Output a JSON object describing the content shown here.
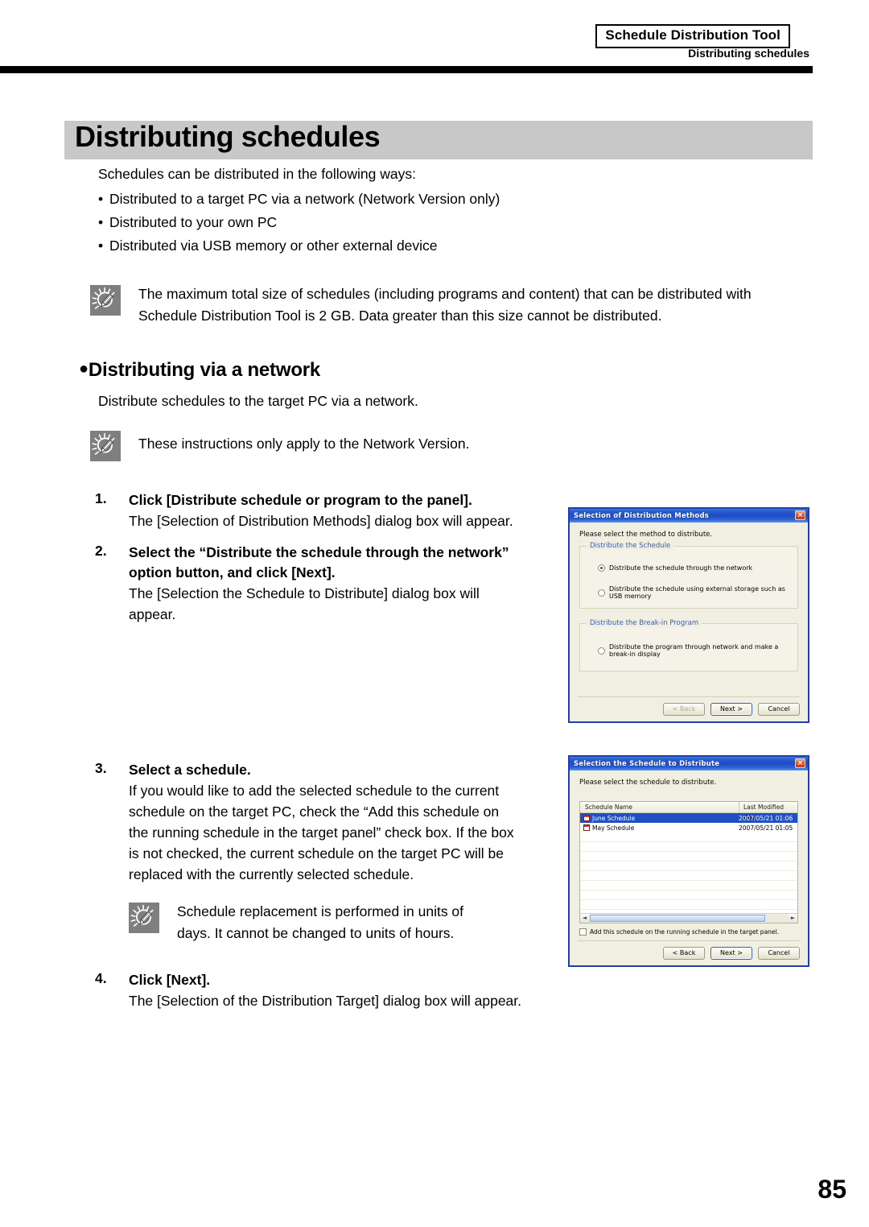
{
  "header": {
    "tool_name": "Schedule Distribution Tool",
    "running_head": "Distributing schedules"
  },
  "title": "Distributing schedules",
  "intro": {
    "lead": "Schedules can be distributed in the following ways:",
    "bullet_char": "•",
    "bullets": [
      "Distributed to a target PC via a network (Network Version only)",
      "Distributed to your own PC",
      "Distributed via USB memory or other external device"
    ]
  },
  "tip_top": {
    "icon": "lightbulb-tip-icon",
    "line1": "The maximum total size of schedules (including programs and content) that can be distributed with",
    "line2": "Schedule Distribution Tool is 2 GB. Data greater than this size cannot be distributed."
  },
  "section": {
    "bullet": "●",
    "heading": "Distributing via a network",
    "intro": "Distribute schedules to the target PC via a network.",
    "tip": {
      "icon": "lightbulb-tip-icon",
      "text": "These instructions only apply to the Network Version."
    }
  },
  "steps": [
    {
      "number": "1.",
      "title": "Click [Distribute schedule or program to the panel].",
      "desc": "The [Selection of Distribution Methods] dialog box will appear."
    },
    {
      "number": "2.",
      "title_line1": "Select the “Distribute the schedule through the network”",
      "title_line2": "option button, and click [Next].",
      "desc_line1": "The [Selection the Schedule to Distribute] dialog box will",
      "desc_line2": "appear."
    },
    {
      "number": "3.",
      "title": "Select a schedule.",
      "desc_lines": [
        "If you would like to add the selected schedule to the current",
        "schedule on the target PC, check the “Add this schedule on",
        "the running schedule in the target panel” check box. If the box",
        "is not checked, the current schedule on the target PC will be",
        "replaced with the currently selected schedule."
      ],
      "tip": {
        "icon": "lightbulb-tip-icon",
        "line1": "Schedule replacement is performed in units of",
        "line2": "days. It cannot be changed to units of hours."
      }
    },
    {
      "number": "4.",
      "title": "Click [Next].",
      "desc": "The [Selection of the Distribution Target] dialog box will appear."
    }
  ],
  "dialog1": {
    "title": "Selection of Distribution Methods",
    "close_label": "×",
    "prompt": "Please select the method to distribute.",
    "group1_label": "Distribute the Schedule",
    "group1_options": [
      {
        "label": "Distribute the schedule through the network",
        "selected": true
      },
      {
        "label": "Distribute the schedule using external storage such as USB memory",
        "selected": false
      }
    ],
    "group2_label": "Distribute the Break-in Program",
    "group2_options": [
      {
        "label": "Distribute the program through network and make a break-in display",
        "selected": false
      }
    ],
    "buttons": [
      {
        "label": "< Back",
        "state": "disabled"
      },
      {
        "label": "Next >",
        "state": "default"
      },
      {
        "label": "Cancel",
        "state": "normal"
      }
    ]
  },
  "dialog2": {
    "title": "Selection the Schedule to Distribute",
    "close_label": "×",
    "prompt": "Please select the schedule to distribute.",
    "columns": [
      "Schedule Name",
      "Last Modified Date"
    ],
    "rows": [
      {
        "name": "June Schedule",
        "date": "2007/05/21 01:06",
        "selected": true
      },
      {
        "name": "May Schedule",
        "date": "2007/05/21 01:05",
        "selected": false
      }
    ],
    "checkbox": {
      "label": "Add this schedule on the running schedule in the target panel.",
      "checked": false
    },
    "buttons": [
      {
        "label": "< Back",
        "state": "normal"
      },
      {
        "label": "Next >",
        "state": "default"
      },
      {
        "label": "Cancel",
        "state": "normal"
      }
    ]
  },
  "page_number": "85",
  "colors": {
    "title_band": "#c8c8c8",
    "rule": "#000000",
    "dialog_titlebar": "#1f49c4",
    "dialog_face": "#f1efe2",
    "selection": "#1f4fc4",
    "group_label": "#3b5fa8"
  }
}
